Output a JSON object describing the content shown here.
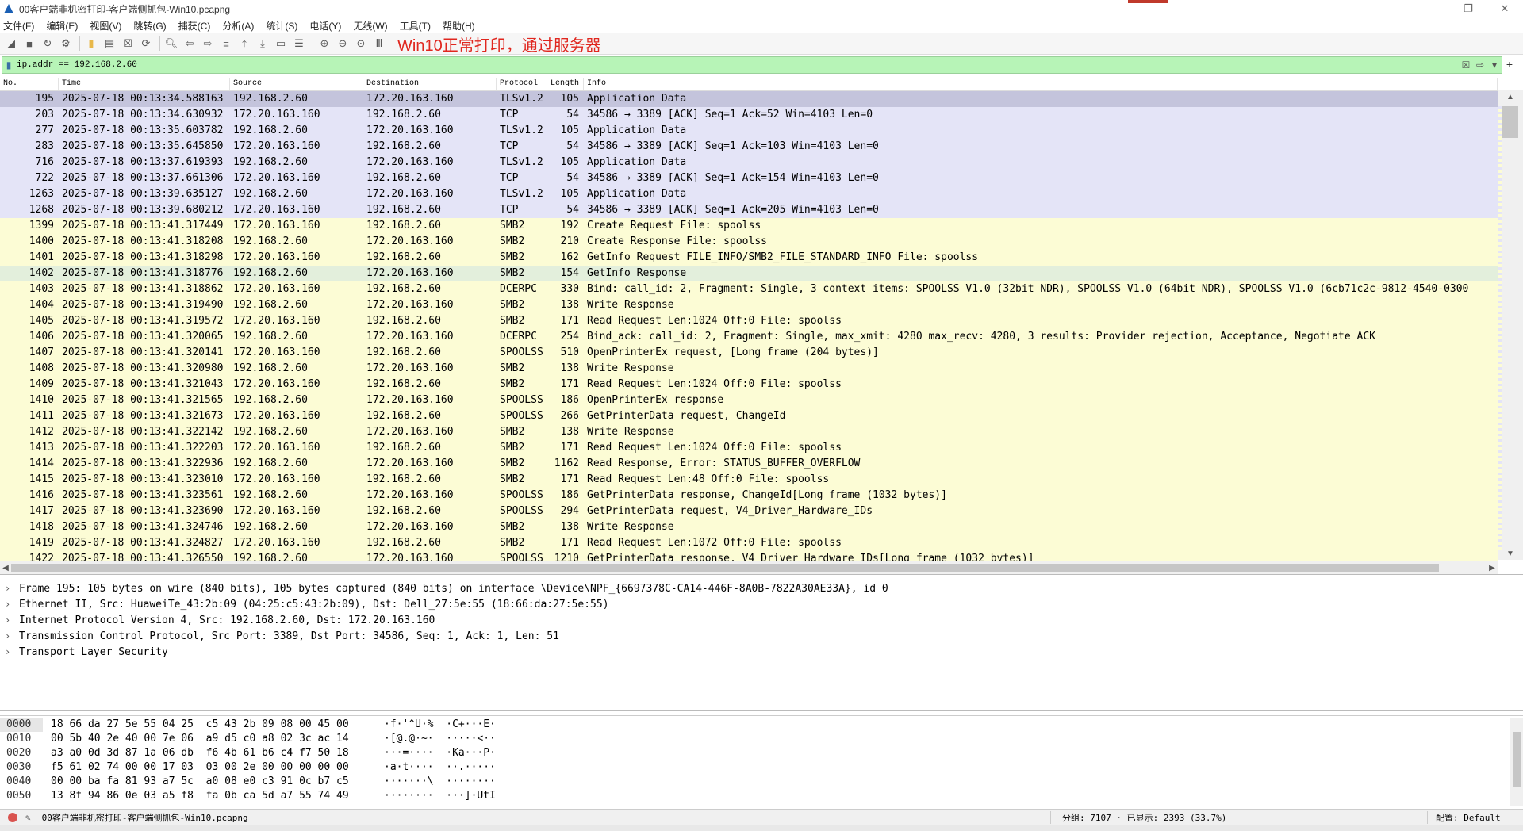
{
  "window": {
    "title": "00客户端非机密打印-客户端侧抓包-Win10.pcapng",
    "minimize": "—",
    "restore": "❐",
    "close": "✕"
  },
  "menu": [
    "文件(F)",
    "编辑(E)",
    "视图(V)",
    "跳转(G)",
    "捕获(C)",
    "分析(A)",
    "统计(S)",
    "电话(Y)",
    "无线(W)",
    "工具(T)",
    "帮助(H)"
  ],
  "toolbar": {
    "annotation": "Win10正常打印，通过服务器"
  },
  "filter": {
    "value": "ip.addr == 192.168.2.60",
    "plus": "+"
  },
  "columns": {
    "no": "No.",
    "time": "Time",
    "source": "Source",
    "destination": "Destination",
    "protocol": "Protocol",
    "length": "Length",
    "info": "Info"
  },
  "packets": [
    [
      "195",
      "2025-07-18 00:13:34.588163",
      "192.168.2.60",
      "172.20.163.160",
      "TLSv1.2",
      "105",
      "Application Data"
    ],
    [
      "203",
      "2025-07-18 00:13:34.630932",
      "172.20.163.160",
      "192.168.2.60",
      "TCP",
      "54",
      "34586 → 3389 [ACK] Seq=1 Ack=52 Win=4103 Len=0"
    ],
    [
      "277",
      "2025-07-18 00:13:35.603782",
      "192.168.2.60",
      "172.20.163.160",
      "TLSv1.2",
      "105",
      "Application Data"
    ],
    [
      "283",
      "2025-07-18 00:13:35.645850",
      "172.20.163.160",
      "192.168.2.60",
      "TCP",
      "54",
      "34586 → 3389 [ACK] Seq=1 Ack=103 Win=4103 Len=0"
    ],
    [
      "716",
      "2025-07-18 00:13:37.619393",
      "192.168.2.60",
      "172.20.163.160",
      "TLSv1.2",
      "105",
      "Application Data"
    ],
    [
      "722",
      "2025-07-18 00:13:37.661306",
      "172.20.163.160",
      "192.168.2.60",
      "TCP",
      "54",
      "34586 → 3389 [ACK] Seq=1 Ack=154 Win=4103 Len=0"
    ],
    [
      "1263",
      "2025-07-18 00:13:39.635127",
      "192.168.2.60",
      "172.20.163.160",
      "TLSv1.2",
      "105",
      "Application Data"
    ],
    [
      "1268",
      "2025-07-18 00:13:39.680212",
      "172.20.163.160",
      "192.168.2.60",
      "TCP",
      "54",
      "34586 → 3389 [ACK] Seq=1 Ack=205 Win=4103 Len=0"
    ],
    [
      "1399",
      "2025-07-18 00:13:41.317449",
      "172.20.163.160",
      "192.168.2.60",
      "SMB2",
      "192",
      "Create Request File: spoolss"
    ],
    [
      "1400",
      "2025-07-18 00:13:41.318208",
      "192.168.2.60",
      "172.20.163.160",
      "SMB2",
      "210",
      "Create Response File: spoolss"
    ],
    [
      "1401",
      "2025-07-18 00:13:41.318298",
      "172.20.163.160",
      "192.168.2.60",
      "SMB2",
      "162",
      "GetInfo Request FILE_INFO/SMB2_FILE_STANDARD_INFO File: spoolss"
    ],
    [
      "1402",
      "2025-07-18 00:13:41.318776",
      "192.168.2.60",
      "172.20.163.160",
      "SMB2",
      "154",
      "GetInfo Response"
    ],
    [
      "1403",
      "2025-07-18 00:13:41.318862",
      "172.20.163.160",
      "192.168.2.60",
      "DCERPC",
      "330",
      "Bind: call_id: 2, Fragment: Single, 3 context items: SPOOLSS V1.0 (32bit NDR), SPOOLSS V1.0 (64bit NDR), SPOOLSS V1.0 (6cb71c2c-9812-4540-0300"
    ],
    [
      "1404",
      "2025-07-18 00:13:41.319490",
      "192.168.2.60",
      "172.20.163.160",
      "SMB2",
      "138",
      "Write Response"
    ],
    [
      "1405",
      "2025-07-18 00:13:41.319572",
      "172.20.163.160",
      "192.168.2.60",
      "SMB2",
      "171",
      "Read Request Len:1024 Off:0 File: spoolss"
    ],
    [
      "1406",
      "2025-07-18 00:13:41.320065",
      "192.168.2.60",
      "172.20.163.160",
      "DCERPC",
      "254",
      "Bind_ack: call_id: 2, Fragment: Single, max_xmit: 4280 max_recv: 4280, 3 results: Provider rejection, Acceptance, Negotiate ACK"
    ],
    [
      "1407",
      "2025-07-18 00:13:41.320141",
      "172.20.163.160",
      "192.168.2.60",
      "SPOOLSS",
      "510",
      "OpenPrinterEx request, [Long frame (204 bytes)]"
    ],
    [
      "1408",
      "2025-07-18 00:13:41.320980",
      "192.168.2.60",
      "172.20.163.160",
      "SMB2",
      "138",
      "Write Response"
    ],
    [
      "1409",
      "2025-07-18 00:13:41.321043",
      "172.20.163.160",
      "192.168.2.60",
      "SMB2",
      "171",
      "Read Request Len:1024 Off:0 File: spoolss"
    ],
    [
      "1410",
      "2025-07-18 00:13:41.321565",
      "192.168.2.60",
      "172.20.163.160",
      "SPOOLSS",
      "186",
      "OpenPrinterEx response"
    ],
    [
      "1411",
      "2025-07-18 00:13:41.321673",
      "172.20.163.160",
      "192.168.2.60",
      "SPOOLSS",
      "266",
      "GetPrinterData request, ChangeId"
    ],
    [
      "1412",
      "2025-07-18 00:13:41.322142",
      "192.168.2.60",
      "172.20.163.160",
      "SMB2",
      "138",
      "Write Response"
    ],
    [
      "1413",
      "2025-07-18 00:13:41.322203",
      "172.20.163.160",
      "192.168.2.60",
      "SMB2",
      "171",
      "Read Request Len:1024 Off:0 File: spoolss"
    ],
    [
      "1414",
      "2025-07-18 00:13:41.322936",
      "192.168.2.60",
      "172.20.163.160",
      "SMB2",
      "1162",
      "Read Response, Error: STATUS_BUFFER_OVERFLOW"
    ],
    [
      "1415",
      "2025-07-18 00:13:41.323010",
      "172.20.163.160",
      "192.168.2.60",
      "SMB2",
      "171",
      "Read Request Len:48 Off:0 File: spoolss"
    ],
    [
      "1416",
      "2025-07-18 00:13:41.323561",
      "192.168.2.60",
      "172.20.163.160",
      "SPOOLSS",
      "186",
      "GetPrinterData response, ChangeId[Long frame (1032 bytes)]"
    ],
    [
      "1417",
      "2025-07-18 00:13:41.323690",
      "172.20.163.160",
      "192.168.2.60",
      "SPOOLSS",
      "294",
      "GetPrinterData request, V4_Driver_Hardware_IDs"
    ],
    [
      "1418",
      "2025-07-18 00:13:41.324746",
      "192.168.2.60",
      "172.20.163.160",
      "SMB2",
      "138",
      "Write Response"
    ],
    [
      "1419",
      "2025-07-18 00:13:41.324827",
      "172.20.163.160",
      "192.168.2.60",
      "SMB2",
      "171",
      "Read Request Len:1072 Off:0 File: spoolss"
    ],
    [
      "1422",
      "2025-07-18 00:13:41.326550",
      "192.168.2.60",
      "172.20.163.160",
      "SPOOLSS",
      "1210",
      "GetPrinterData response, V4_Driver_Hardware_IDs[Long frame (1032 bytes)]"
    ]
  ],
  "details": [
    "Frame 195: 105 bytes on wire (840 bits), 105 bytes captured (840 bits) on interface \\Device\\NPF_{6697378C-CA14-446F-8A0B-7822A30AE33A}, id 0",
    "Ethernet II, Src: HuaweiTe_43:2b:09 (04:25:c5:43:2b:09), Dst: Dell_27:5e:55 (18:66:da:27:5e:55)",
    "Internet Protocol Version 4, Src: 192.168.2.60, Dst: 172.20.163.160",
    "Transmission Control Protocol, Src Port: 3389, Dst Port: 34586, Seq: 1, Ack: 1, Len: 51",
    "Transport Layer Security"
  ],
  "bytes": [
    [
      "0000",
      "18 66 da 27 5e 55 04 25  c5 43 2b 09 08 00 45 00",
      "·f·'^U·%  ·C+···E·"
    ],
    [
      "0010",
      "00 5b 40 2e 40 00 7e 06  a9 d5 c0 a8 02 3c ac 14",
      "·[@.@·~·  ·····<··"
    ],
    [
      "0020",
      "a3 a0 0d 3d 87 1a 06 db  f6 4b 61 b6 c4 f7 50 18",
      "···=····  ·Ka···P·"
    ],
    [
      "0030",
      "f5 61 02 74 00 00 17 03  03 00 2e 00 00 00 00 00",
      "·a·t····  ··.·····"
    ],
    [
      "0040",
      "00 00 ba fa 81 93 a7 5c  a0 08 e0 c3 91 0c b7 c5",
      "·······\\  ········"
    ],
    [
      "0050",
      "13 8f 94 86 0e 03 a5 f8  fa 0b ca 5d a7 55 74 49",
      "········  ···]·UtI"
    ]
  ],
  "status": {
    "file": "00客户端非机密打印-客户端侧抓包-Win10.pcapng",
    "stats": "分组: 7107 · 已显示: 2393 (33.7%)",
    "profile": "配置: Default"
  },
  "colors": {
    "tcp_row": "#e4e4f7",
    "smb_row": "#fcfcd5",
    "selected_row": "#c4c4dc",
    "filter_ok": "#b7f4b7",
    "annotation": "#e0271f"
  }
}
